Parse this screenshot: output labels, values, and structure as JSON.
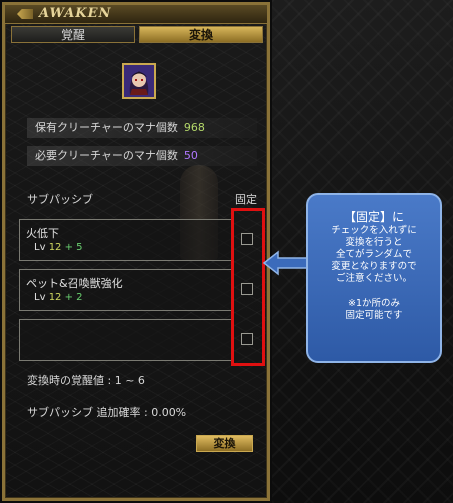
{
  "window": {
    "title": "AWAKEN"
  },
  "tabs": [
    {
      "label": "覚醒",
      "active": false
    },
    {
      "label": "変換",
      "active": true
    }
  ],
  "mana": {
    "owned_label": "保有クリーチャーのマナ個数",
    "owned_value": "968",
    "required_label": "必要クリーチャーのマナ個数",
    "required_value": "50"
  },
  "sub_passive": {
    "heading": "サブパッシブ",
    "fixed_heading": "固定",
    "slots": [
      {
        "name": "火低下",
        "lv_prefix": "Lv",
        "lv": "12",
        "plus": "+ 5",
        "fixed": false
      },
      {
        "name": "ペット&召喚獣強化",
        "lv_prefix": "Lv",
        "lv": "12",
        "plus": "+ 2",
        "fixed": false
      },
      {
        "name": "",
        "lv_prefix": "",
        "lv": "",
        "plus": "",
        "fixed": false
      }
    ]
  },
  "footer": {
    "awaken_value_line": "変換時の覚醒値 : 1 ~ 6",
    "add_rate_line": "サブパッシブ 追加確率 : 0.00%"
  },
  "convert_button": {
    "label": "変換"
  },
  "callout": {
    "lines": [
      "【固定】に",
      "チェックを入れずに",
      "変換を行うと",
      "全てがランダムで",
      "変更となりますので",
      "ご注意ください。",
      "※1か所のみ",
      "固定可能です"
    ]
  },
  "colors": {
    "accent_gold": "#c9a850",
    "highlight_red": "#e01010",
    "callout_blue": "#3b6bbb",
    "mana_owned": "#b4d86a",
    "mana_required": "#b078ff"
  }
}
